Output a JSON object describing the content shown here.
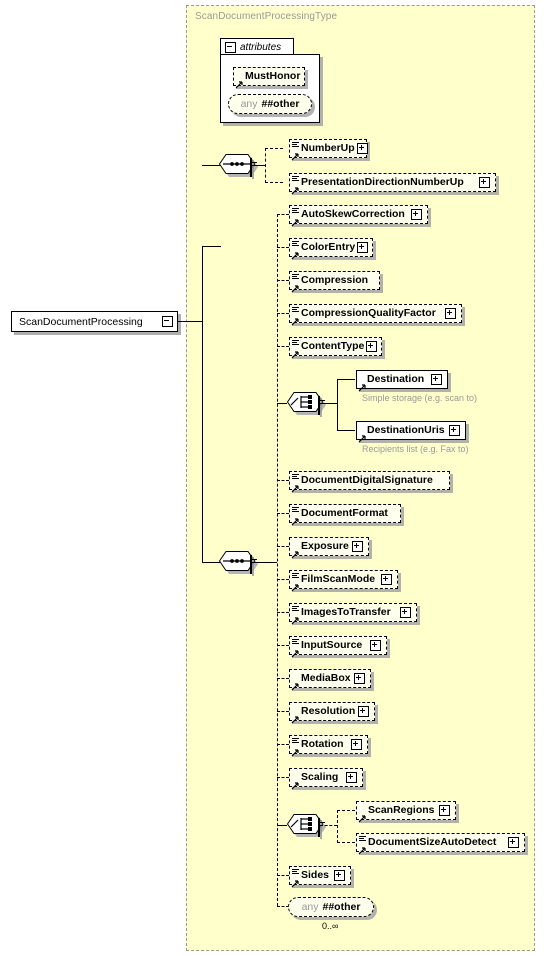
{
  "diagram": {
    "kind": "xsd-schema-diagram",
    "root_element": {
      "label": "ScanDocumentProcessing",
      "toggle": "minus"
    },
    "type_container": {
      "title": "ScanDocumentProcessingType"
    },
    "attributes_group": {
      "label": "attributes",
      "toggle": "minus",
      "items": [
        {
          "label": "MustHonor",
          "style": "dashed",
          "has_expand": false
        },
        {
          "any_label": "any",
          "namespace": "##other",
          "style": "pill"
        }
      ]
    },
    "compositors": {
      "inner_sequence": {
        "type": "sequence",
        "toggle": "minus"
      },
      "main_sequence": {
        "type": "sequence",
        "toggle": "minus"
      },
      "destination_choice": {
        "type": "choice",
        "toggle": "minus"
      },
      "scanregion_choice": {
        "type": "choice",
        "toggle": "minus"
      }
    },
    "elements": [
      {
        "label": "NumberUp",
        "optional": true,
        "has_expand": true,
        "has_seqmark": true
      },
      {
        "label": "PresentationDirectionNumberUp",
        "optional": true,
        "has_expand": true,
        "has_seqmark": true
      },
      {
        "label": "AutoSkewCorrection",
        "optional": true,
        "has_expand": true,
        "has_seqmark": true
      },
      {
        "label": "ColorEntry",
        "optional": true,
        "has_expand": true,
        "has_seqmark": true
      },
      {
        "label": "Compression",
        "optional": true,
        "has_expand": false,
        "has_seqmark": true
      },
      {
        "label": "CompressionQualityFactor",
        "optional": true,
        "has_expand": true,
        "has_seqmark": true
      },
      {
        "label": "ContentType",
        "optional": true,
        "has_expand": true,
        "has_seqmark": true
      },
      {
        "label": "Destination",
        "optional": false,
        "has_expand": true,
        "has_seqmark": false,
        "annotation": "Simple storage (e.g. scan to)"
      },
      {
        "label": "DestinationUris",
        "optional": false,
        "has_expand": true,
        "has_seqmark": false,
        "annotation": "Recipients list (e.g. Fax to)"
      },
      {
        "label": "DocumentDigitalSignature",
        "optional": true,
        "has_expand": false,
        "has_seqmark": true
      },
      {
        "label": "DocumentFormat",
        "optional": true,
        "has_expand": false,
        "has_seqmark": true
      },
      {
        "label": "Exposure",
        "optional": true,
        "has_expand": true,
        "has_seqmark": false
      },
      {
        "label": "FilmScanMode",
        "optional": true,
        "has_expand": true,
        "has_seqmark": true
      },
      {
        "label": "ImagesToTransfer",
        "optional": true,
        "has_expand": true,
        "has_seqmark": true
      },
      {
        "label": "InputSource",
        "optional": true,
        "has_expand": true,
        "has_seqmark": true
      },
      {
        "label": "MediaBox",
        "optional": true,
        "has_expand": true,
        "has_seqmark": false
      },
      {
        "label": "Resolution",
        "optional": true,
        "has_expand": true,
        "has_seqmark": false
      },
      {
        "label": "Rotation",
        "optional": true,
        "has_expand": true,
        "has_seqmark": true
      },
      {
        "label": "Scaling",
        "optional": true,
        "has_expand": true,
        "has_seqmark": false
      },
      {
        "label": "ScanRegions",
        "optional": true,
        "has_expand": true,
        "has_seqmark": false
      },
      {
        "label": "DocumentSizeAutoDetect",
        "optional": true,
        "has_expand": true,
        "has_seqmark": true
      },
      {
        "label": "Sides",
        "optional": true,
        "has_expand": true,
        "has_seqmark": true
      },
      {
        "any_label": "any",
        "namespace": "##other",
        "style": "pill",
        "cardinality": "0..∞"
      }
    ],
    "colors": {
      "type_fill": "#ffffcc",
      "element_fill": "#ffffee",
      "required_fill": "#ffffff",
      "border": "#000000",
      "dashed_border": "#999999",
      "annotation_text": "#999999",
      "shadow": "#a5a5a5"
    }
  }
}
